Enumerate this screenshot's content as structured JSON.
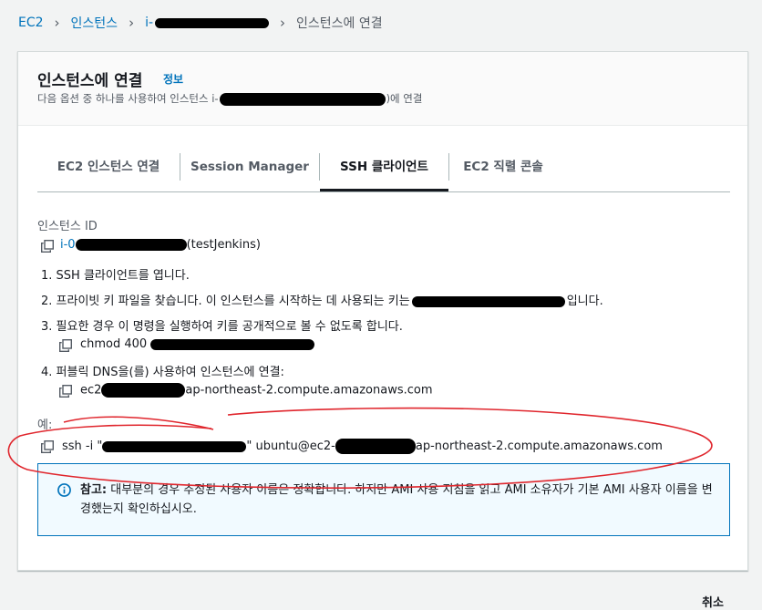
{
  "breadcrumb": {
    "items": [
      "EC2",
      "인스턴스",
      "i-",
      "인스턴스에 연결"
    ]
  },
  "header": {
    "title": "인스턴스에 연결",
    "info_link": "정보",
    "description_prefix": "다음 옵션 중 하나를 사용하여 인스턴스 i-",
    "description_suffix": ")에 연결"
  },
  "tabs": [
    {
      "label": "EC2 인스턴스 연결",
      "active": false
    },
    {
      "label": "Session Manager",
      "active": false
    },
    {
      "label": "SSH 클라이언트",
      "active": true
    },
    {
      "label": "EC2 직렬 콘솔",
      "active": false
    }
  ],
  "instance": {
    "label": "인스턴스 ID",
    "id_prefix": "i-0",
    "name": "(testJenkins)"
  },
  "steps": {
    "s1": "1. SSH 클라이언트를 엽니다.",
    "s2_prefix": "2. 프라이빗 키 파일을 찾습니다. 이 인스턴스를 시작하는 데 사용되는 키는",
    "s2_suffix": "입니다.",
    "s3": "3. 필요한 경우 이 명령을 실행하여 키를 공개적으로 볼 수 없도록 합니다.",
    "s3_cmd": "chmod 400",
    "s4": "4. 퍼블릭 DNS을(를) 사용하여 인스턴스에 연결:",
    "s4_dns_prefix": "ec2",
    "s4_dns_suffix": "ap-northeast-2.compute.amazonaws.com"
  },
  "example": {
    "label": "예:",
    "cmd_prefix": "ssh -i \"",
    "cmd_mid": "\" ubuntu@ec2-",
    "cmd_suffix": "ap-northeast-2.compute.amazonaws.com"
  },
  "alert": {
    "bold": "참고:",
    "text": " 대부분의 경우 추정된 사용자 이름은 정확합니다. 하지만 AMI 사용 지침을 읽고 AMI 소유자가 기본 AMI 사용자 이름을 변경했는지 확인하십시오."
  },
  "footer": {
    "cancel": "취소"
  },
  "colors": {
    "link": "#0073bb",
    "annotation": "#e0262d"
  }
}
